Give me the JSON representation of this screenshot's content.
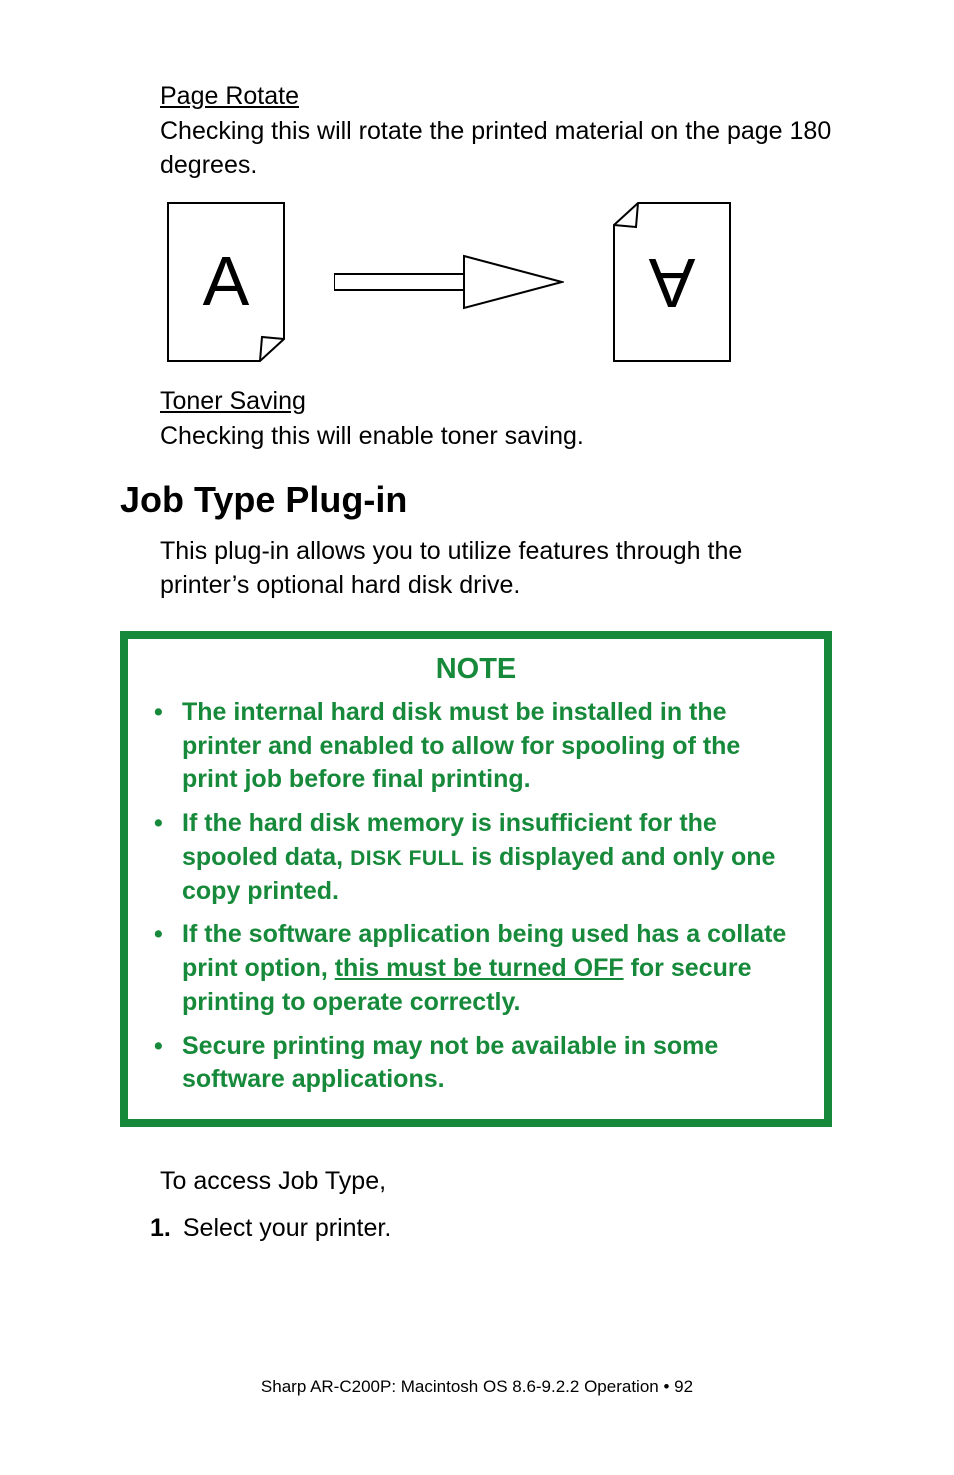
{
  "pageRotate": {
    "heading": "Page Rotate",
    "body": "Checking this will rotate the printed material on the page 180 degrees."
  },
  "diagram": {
    "leftGlyph": "A",
    "rightGlyph": "A"
  },
  "tonerSaving": {
    "heading": "Toner Saving",
    "body": "Checking this will enable toner saving."
  },
  "section": {
    "title": "Job Type Plug-in",
    "intro": "This plug-in allows you to utilize features through the printer’s optional hard disk drive."
  },
  "note": {
    "title": "NOTE",
    "items": [
      {
        "text": "The internal hard disk must be installed in the printer and enabled to allow for spooling of the print job before final printing."
      },
      {
        "pre": "If the hard disk memory is insufficient for the spooled data, ",
        "mono": "DISK FULL",
        "post": " is displayed and only one copy printed."
      },
      {
        "pre": "If the software application being used has a collate print option, ",
        "underline": "this must be turned OFF",
        "post": " for secure printing to operate correctly."
      },
      {
        "text": "Secure printing may not be available in some software applications."
      }
    ]
  },
  "access": {
    "lead": "To access Job Type,",
    "step1_num": "1.",
    "step1_text": "Select your printer."
  },
  "footer": "Sharp AR-C200P: Macintosh OS 8.6-9.2.2 Operation   •   92"
}
